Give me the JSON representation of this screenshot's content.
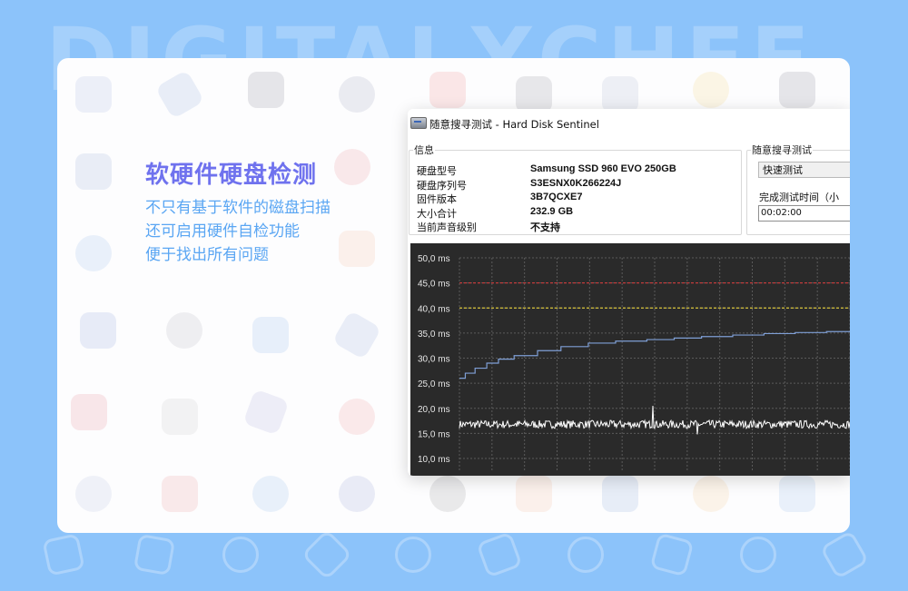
{
  "brand": {
    "watermark": "DIGITALXCHEF"
  },
  "promo": {
    "title": "软硬件硬盘检测",
    "lines": [
      "不只有基于软件的磁盘扫描",
      "还可启用硬件自检功能",
      "便于找出所有问题"
    ]
  },
  "window": {
    "title": "随意搜寻测试 - Hard Disk Sentinel",
    "info_group": {
      "legend": "信息",
      "rows": [
        {
          "label": "硬盘型号",
          "value": "Samsung SSD 960 EVO 250GB"
        },
        {
          "label": "硬盘序列号",
          "value": "S3ESNX0K266224J"
        },
        {
          "label": "固件版本",
          "value": "3B7QCXE7"
        },
        {
          "label": "大小合计",
          "value": "232.9 GB"
        },
        {
          "label": "当前声音级别",
          "value": "不支持"
        }
      ]
    },
    "test_group": {
      "legend": "随意搜寻测试",
      "test_type": "快速测试",
      "duration_label": "完成测试时间（小",
      "duration_value": "00:02:00"
    }
  },
  "chart_data": {
    "type": "line",
    "y_unit": "ms",
    "y_ticks": [
      "50,0 ms",
      "45,0 ms",
      "40,0 ms",
      "35,0 ms",
      "30,0 ms",
      "25,0 ms",
      "20,0 ms",
      "15,0 ms",
      "10,0 ms"
    ],
    "ylim": [
      10,
      50
    ],
    "x_range": [
      0,
      100
    ],
    "grid": true,
    "reference_lines": [
      {
        "value": 45,
        "color": "#c03a3a",
        "style": "dashed"
      },
      {
        "value": 40,
        "color": "#d8c43a",
        "style": "dashed"
      }
    ],
    "series": [
      {
        "color": "#7f9fd6",
        "points": [
          [
            0,
            26
          ],
          [
            1.5,
            27
          ],
          [
            4,
            28
          ],
          [
            7,
            29
          ],
          [
            10,
            29.8
          ],
          [
            14,
            30.5
          ],
          [
            20,
            31.5
          ],
          [
            26,
            32.3
          ],
          [
            33,
            33
          ],
          [
            40,
            33.4
          ],
          [
            48,
            33.7
          ],
          [
            55,
            34
          ],
          [
            62,
            34.3
          ],
          [
            70,
            34.6
          ],
          [
            78,
            34.9
          ],
          [
            86,
            35.1
          ],
          [
            94,
            35.3
          ],
          [
            100,
            35.4
          ]
        ]
      },
      {
        "color": "#ffffff",
        "baseline": 16.8,
        "spread": 1.6,
        "spikes": [
          [
            49.5,
            20.5
          ],
          [
            61,
            14.8
          ]
        ]
      }
    ]
  },
  "colors": {
    "background": "#8cc3fa",
    "promo_title": "#6f72ee",
    "promo_text": "#5aa6f3",
    "chart_background": "#2a2a2a"
  }
}
